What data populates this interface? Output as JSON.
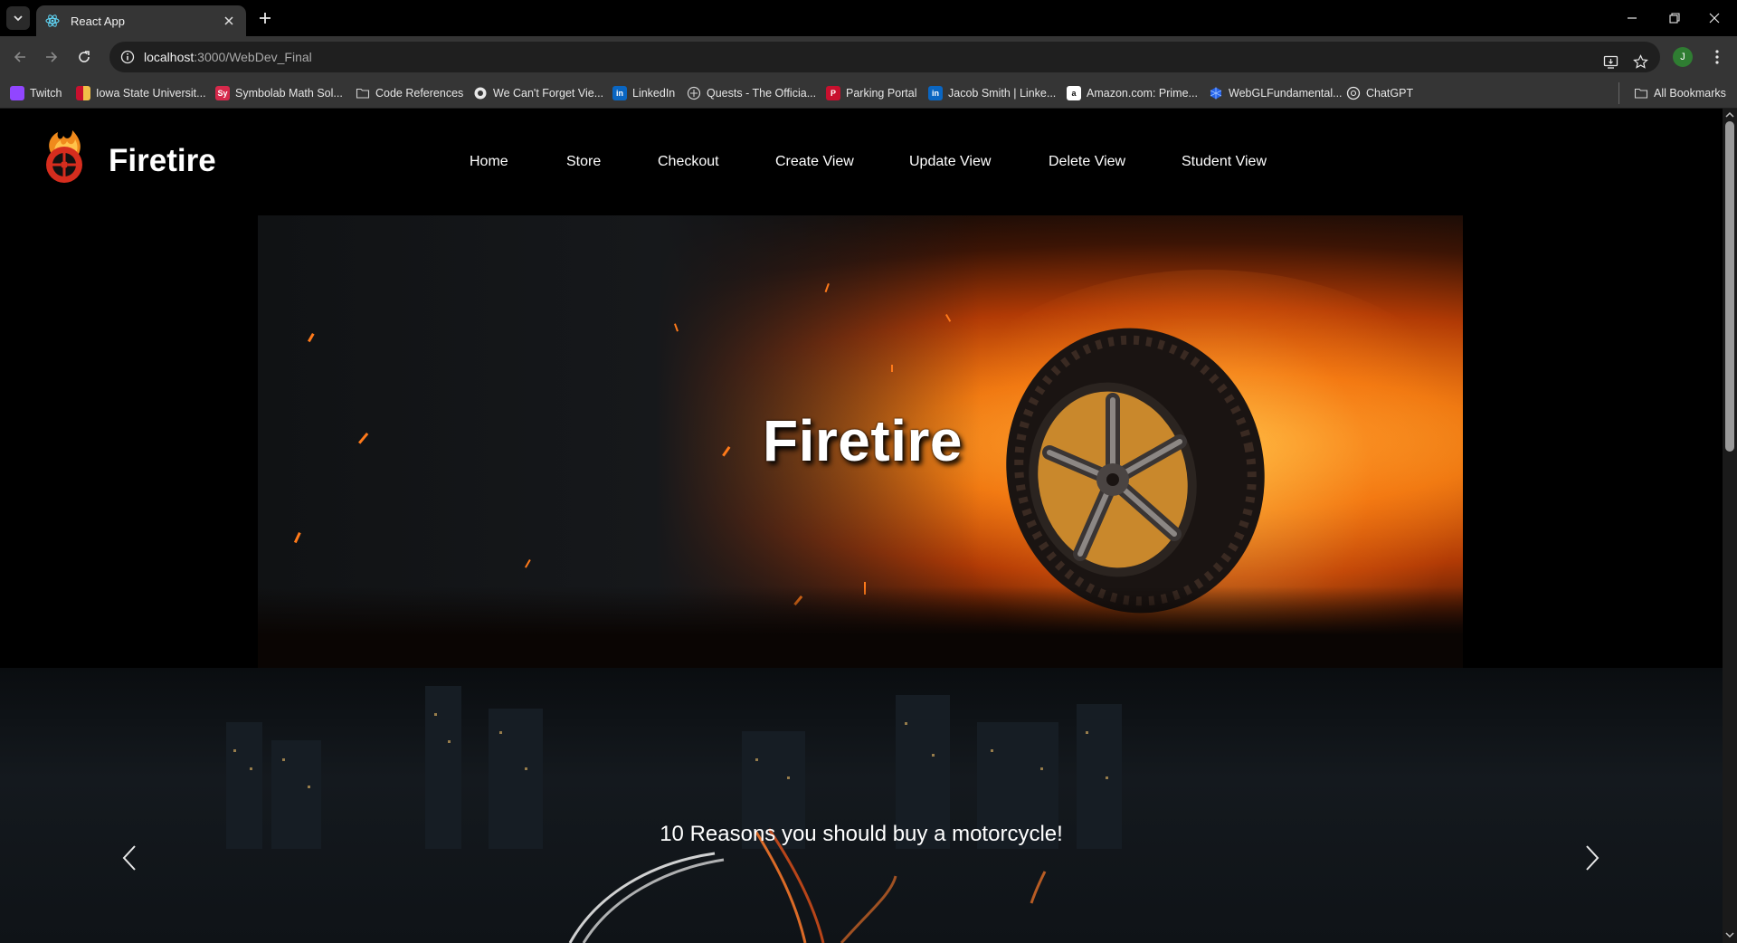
{
  "browser": {
    "tab_title": "React App",
    "url_host": "localhost",
    "url_path": ":3000/WebDev_Final",
    "profile_initial": "J",
    "bookmarks": [
      {
        "label": "Twitch",
        "icon": "twitch-icon",
        "color": "#9146ff"
      },
      {
        "label": "Iowa State Universit...",
        "icon": "isu-icon",
        "color": "#c8102e"
      },
      {
        "label": "Symbolab Math Sol...",
        "icon": "symbolab-icon",
        "color": "#d6294b"
      },
      {
        "label": "Code References",
        "icon": "folder-icon",
        "color": ""
      },
      {
        "label": "We Can't Forget Vie...",
        "icon": "forget-icon",
        "color": "#1f1f1f"
      },
      {
        "label": "LinkedIn",
        "icon": "linkedin-icon",
        "color": "#0a66c2"
      },
      {
        "label": "Quests - The Officia...",
        "icon": "quests-icon",
        "color": ""
      },
      {
        "label": "Parking Portal",
        "icon": "parking-icon",
        "color": "#c8102e"
      },
      {
        "label": "Jacob Smith | Linke...",
        "icon": "linkedin-icon",
        "color": "#0a66c2"
      },
      {
        "label": "Amazon.com: Prime...",
        "icon": "amazon-icon",
        "color": "#ffffff"
      },
      {
        "label": "WebGLFundamental...",
        "icon": "webgl-icon",
        "color": "#2563eb"
      },
      {
        "label": "ChatGPT",
        "icon": "chatgpt-icon",
        "color": ""
      }
    ],
    "all_bookmarks_label": "All Bookmarks"
  },
  "site": {
    "brand": "Firetire",
    "nav": [
      {
        "label": "Home"
      },
      {
        "label": "Store"
      },
      {
        "label": "Checkout"
      },
      {
        "label": "Create View"
      },
      {
        "label": "Update View"
      },
      {
        "label": "Delete View"
      },
      {
        "label": "Student View"
      }
    ],
    "hero_title": "Firetire",
    "carousel_caption": "10 Reasons you should buy a motorcycle!"
  },
  "colors": {
    "accent_fire": "#f07a12",
    "logo_red": "#d62d1e"
  }
}
